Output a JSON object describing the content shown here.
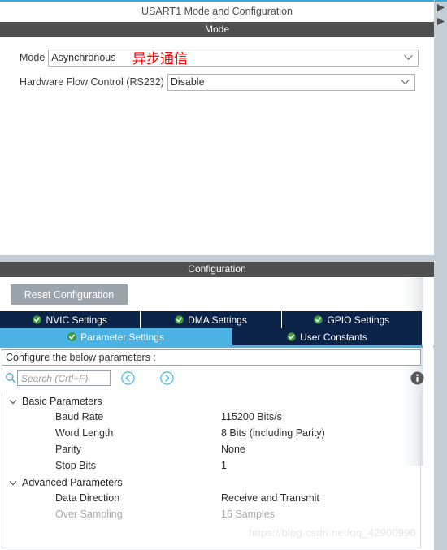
{
  "window": {
    "title": "USART1 Mode and Configuration"
  },
  "mode_panel": {
    "section_title": "Mode",
    "annotation_cn": "异步通信",
    "annotation_color": "#ff0000",
    "rows": [
      {
        "label": "Mode",
        "value": "Asynchronous"
      },
      {
        "label": "Hardware Flow Control (RS232)",
        "value": "Disable"
      }
    ]
  },
  "config_panel": {
    "section_title": "Configuration",
    "reset_button": "Reset Configuration",
    "tabs_row_1": [
      {
        "label": "NVIC Settings",
        "icon": "check-circle-icon",
        "active": false
      },
      {
        "label": "DMA Settings",
        "icon": "check-circle-icon",
        "active": false
      },
      {
        "label": "GPIO Settings",
        "icon": "check-circle-icon",
        "active": false
      }
    ],
    "tabs_row_2": [
      {
        "label": "Parameter Settings",
        "icon": "check-circle-icon",
        "active": true
      },
      {
        "label": "User Constants",
        "icon": "check-circle-icon",
        "active": false
      }
    ],
    "configure_hint": "Configure the below parameters :",
    "search": {
      "placeholder": "Search (Crtl+F)",
      "value": "",
      "icon": "search-icon",
      "prev_icon": "circle-left-arrow-icon",
      "next_icon": "circle-right-arrow-icon"
    },
    "info_icon": "info-icon",
    "groups": [
      {
        "title": "Basic Parameters",
        "expanded": true,
        "params": [
          {
            "name": "Baud Rate",
            "value": "115200 Bits/s",
            "disabled": false
          },
          {
            "name": "Word Length",
            "value": "8 Bits (including Parity)",
            "disabled": false
          },
          {
            "name": "Parity",
            "value": "None",
            "disabled": false
          },
          {
            "name": "Stop Bits",
            "value": "1",
            "disabled": false
          }
        ]
      },
      {
        "title": "Advanced Parameters",
        "expanded": true,
        "params": [
          {
            "name": "Data Direction",
            "value": "Receive and Transmit",
            "disabled": false
          },
          {
            "name": "Over Sampling",
            "value": "16 Samples",
            "disabled": true
          }
        ]
      }
    ]
  },
  "watermark": "https://blog.csdn.net/qq_42900996",
  "colors": {
    "accent_blue": "#35a8e0",
    "tab_active": "#4cb2e3",
    "tab_inactive": "#0b2349",
    "section_header": "#4f4f4f",
    "panel_bg": "#c2cdd6",
    "annotation_red": "#ff0000"
  },
  "scrollbar": {
    "up_icon": "scroll-up-arrow-icon",
    "down_icon": "scroll-down-arrow-icon"
  }
}
